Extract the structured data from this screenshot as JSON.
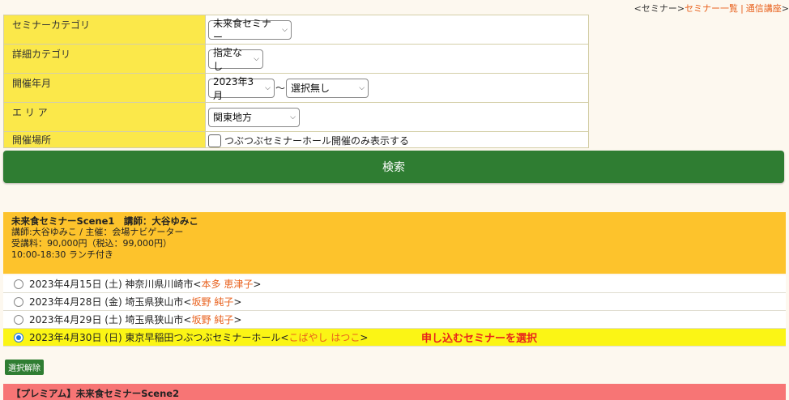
{
  "nav": {
    "prefix": "<セミナー>",
    "link1": "セミナー一覧",
    "sep": "|",
    "link2": "通信講座",
    "suffix": ">"
  },
  "filters": {
    "category": {
      "label": "セミナーカテゴリ",
      "value": "未来食セミナー"
    },
    "detail": {
      "label": "詳細カテゴリ",
      "value": "指定なし"
    },
    "date": {
      "label": "開催年月",
      "from": "2023年3月",
      "tilde": "〜",
      "to": "選択無し"
    },
    "area": {
      "label": "エ リ ア",
      "value": "関東地方"
    },
    "venue": {
      "label": "開催場所",
      "checkbox_label": "つぶつぶセミナーホール開催のみ表示する"
    }
  },
  "search_label": "検索",
  "seminar1": {
    "title": "未来食セミナーScene1　講師：大谷ゆみこ",
    "organizer": "講師:大谷ゆみこ / 主催：会場ナビゲーター",
    "fee": "受講料：90,000円（税込：99,000円）",
    "time": "10:00-18:30 ランチ付き",
    "dates": [
      {
        "text": "2023年4月15日 (土) 神奈川県川崎市<",
        "teacher": "本多 恵津子",
        "close": ">",
        "selected": false
      },
      {
        "text": "2023年4月28日 (金) 埼玉県狭山市<",
        "teacher": "坂野 純子",
        "close": ">",
        "selected": false
      },
      {
        "text": "2023年4月29日 (土) 埼玉県狭山市<",
        "teacher": "坂野 純子",
        "close": ">",
        "selected": false
      },
      {
        "text": "2023年4月30日 (日) 東京早稲田つぶつぶセミナーホール<",
        "teacher": "こばやし はつこ",
        "close": ">",
        "selected": true
      }
    ],
    "hint": "申し込むセミナーを選択"
  },
  "clear_label": "選択解除",
  "seminar2_title": "【プレミアム】未来食セミナーScene2",
  "colors": {
    "filter_label_bg": "#fbe84a",
    "search_bg": "#2f7d32",
    "seminar_bg": "#fdc32c",
    "selected_row": "#fbf515",
    "premium_bg": "#f77575",
    "accent": "#e8601c"
  }
}
